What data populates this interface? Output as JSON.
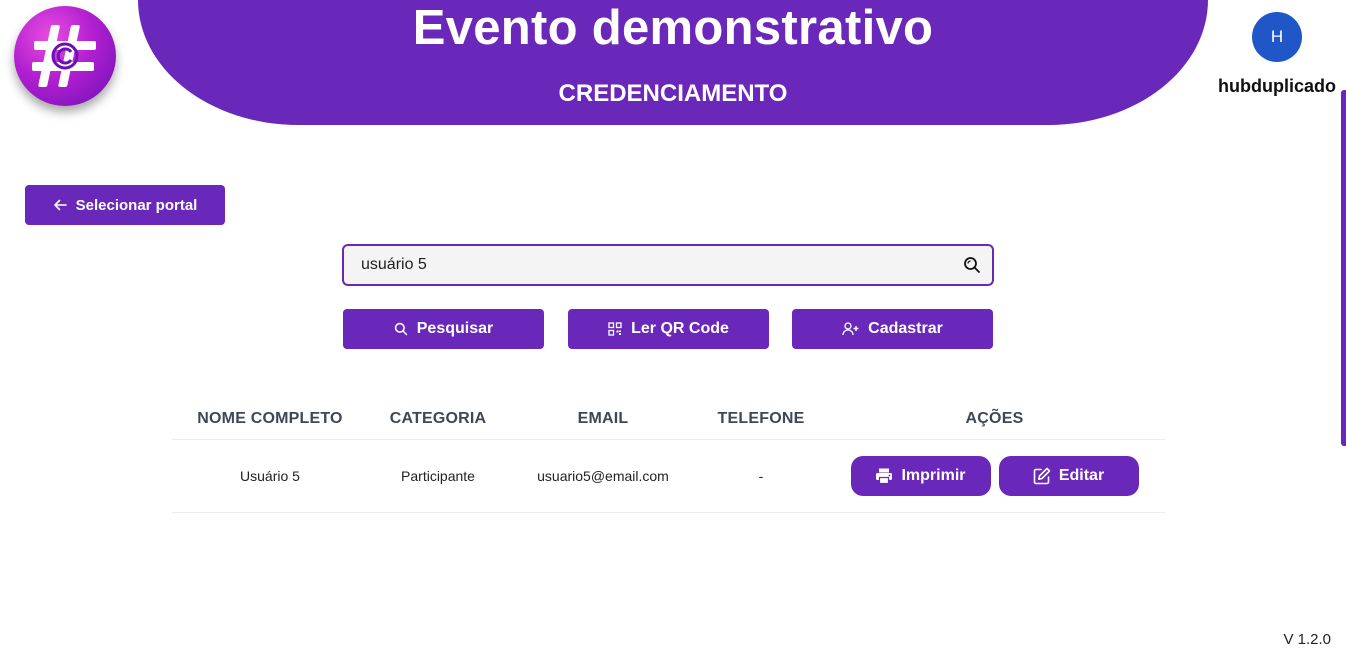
{
  "header": {
    "title": "Evento demonstrativo",
    "subtitle": "CREDENCIAMENTO",
    "logo_icon": "hashtag-logo-icon"
  },
  "user": {
    "initial": "H",
    "name": "hubduplicado"
  },
  "nav": {
    "back_label": "Selecionar portal",
    "back_icon": "arrow-left-icon"
  },
  "search": {
    "value": "usuário 5",
    "placeholder": "",
    "icon": "search-icon"
  },
  "actions": {
    "search_label": "Pesquisar",
    "qr_label": "Ler QR Code",
    "register_label": "Cadastrar"
  },
  "table": {
    "columns": [
      "NOME COMPLETO",
      "CATEGORIA",
      "EMAIL",
      "TELEFONE",
      "AÇÕES"
    ],
    "rows": [
      {
        "name": "Usuário 5",
        "category": "Participante",
        "email": "usuario5@email.com",
        "phone": "-",
        "print_label": "Imprimir",
        "edit_label": "Editar"
      }
    ]
  },
  "footer": {
    "version": "V 1.2.0"
  },
  "colors": {
    "primary": "#6a28bb",
    "avatar": "#1f57c9"
  }
}
